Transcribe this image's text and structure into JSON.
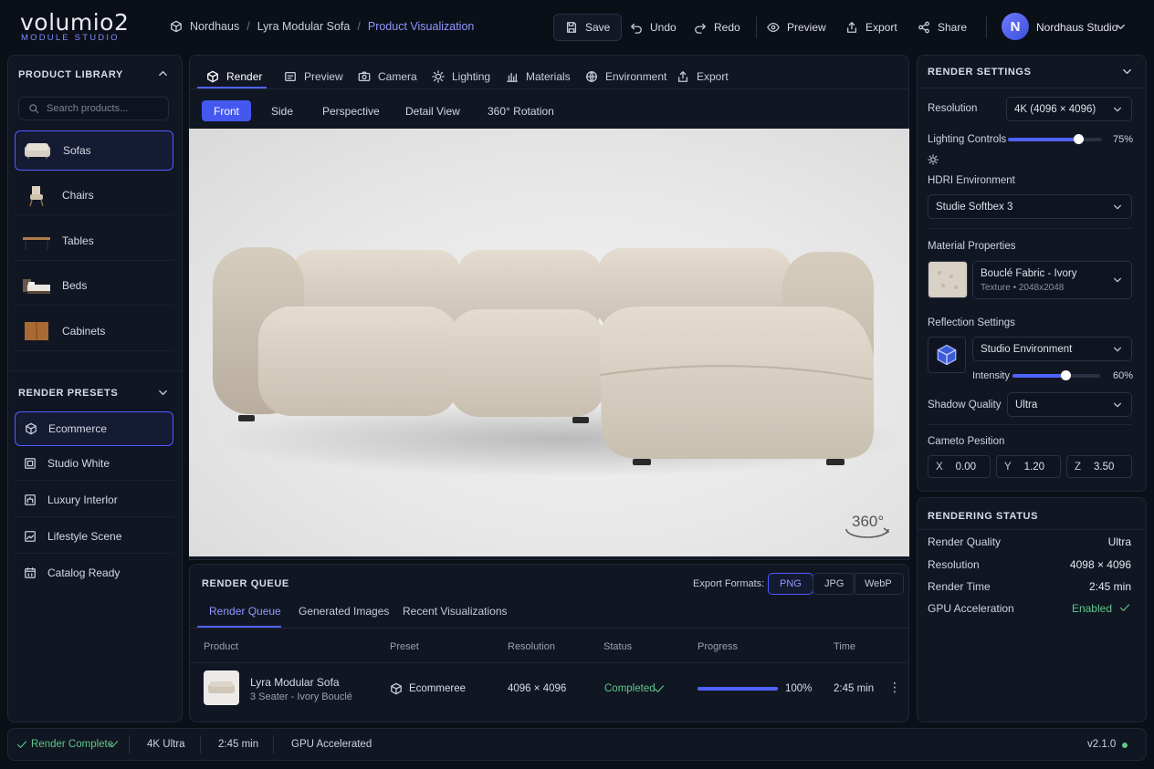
{
  "app": {
    "logo": "volumio2",
    "subtitle": "MODULE STUDIO"
  },
  "breadcrumbs": [
    "Nordhaus",
    "Lyra Modular Sofa",
    "Product Visualization"
  ],
  "toolbar": {
    "save": "Save",
    "undo": "Undo",
    "redo": "Redo",
    "preview": "Preview",
    "export": "Export",
    "share": "Share"
  },
  "user": {
    "initial": "N",
    "name": "Nordhaus Studio"
  },
  "library": {
    "title": "PRODUCT LIBRARY",
    "search_placeholder": "Search products...",
    "items": [
      {
        "label": "Sofas"
      },
      {
        "label": "Chairs"
      },
      {
        "label": "Tables"
      },
      {
        "label": "Beds"
      },
      {
        "label": "Cabinets"
      }
    ]
  },
  "presets": {
    "title": "RENDER PRESETS",
    "items": [
      {
        "label": "Ecommerce"
      },
      {
        "label": "Studio White"
      },
      {
        "label": "Luxury Interlor"
      },
      {
        "label": "Lifestyle Scene"
      },
      {
        "label": "Catalog Ready"
      }
    ]
  },
  "tabs": [
    "Render",
    "Preview",
    "Camera",
    "Lighting",
    "Materials",
    "Environment",
    "Export"
  ],
  "views": [
    "Front",
    "Side",
    "Perspective",
    "Detail View",
    "360° Rotation"
  ],
  "viewport": {
    "badge": "360°"
  },
  "queue": {
    "title": "RENDER QUEUE",
    "export_label": "Export Formats:",
    "formats": [
      "PNG",
      "JPG",
      "WebP"
    ],
    "tabs": [
      "Render Queue",
      "Generated Images",
      "Recent Visualizations"
    ],
    "columns": [
      "Product",
      "Preset",
      "Resolution",
      "Status",
      "Progress",
      "Time"
    ],
    "row": {
      "product": "Lyra Modular Sofa",
      "variant": "3 Seater - Ivory Bouclé",
      "preset": "Ecommeree",
      "resolution": "4096 × 4096",
      "status": "Completed",
      "progress": 100,
      "progress_label": "100%",
      "time": "2:45 min"
    }
  },
  "settings": {
    "title": "RENDER SETTINGS",
    "resolution_label": "Resolution",
    "resolution_value": "4K (4096 × 4096)",
    "lighting_label": "Lighting Controls",
    "lighting_value": 75,
    "lighting_text": "75%",
    "hdri_label": "HDRI Environment",
    "hdri_value": "Studie Softbex 3",
    "material_label": "Material Properties",
    "material_name": "Bouclé Fabric - Ivory",
    "material_sub": "Texture • 2048x2048",
    "reflection_label": "Reflection Settings",
    "reflection_value": "Studio Environment",
    "intensity_label": "Intensity",
    "intensity_value": 60,
    "intensity_text": "60%",
    "shadow_label": "Shadow Quality",
    "shadow_value": "Ultra",
    "camera_label": "Cameto Pesition",
    "camera": {
      "x": "0.00",
      "y": "1.20",
      "z": "3.50"
    }
  },
  "status": {
    "title": "RENDERING STATUS",
    "rows": [
      {
        "label": "Render Quality",
        "value": "Ultra"
      },
      {
        "label": "Resolution",
        "value": "4098 × 4096"
      },
      {
        "label": "Render Time",
        "value": "2:45 min"
      },
      {
        "label": "GPU Acceleration",
        "value": "Enabled"
      }
    ]
  },
  "statusbar": {
    "complete": "Render Complete",
    "quality": "4K Ultra",
    "time": "2:45 min",
    "gpu": "GPU Accelerated",
    "version": "v2.1.0"
  },
  "colors": {
    "accent": "#4f63ff",
    "success": "#5fc88a"
  }
}
